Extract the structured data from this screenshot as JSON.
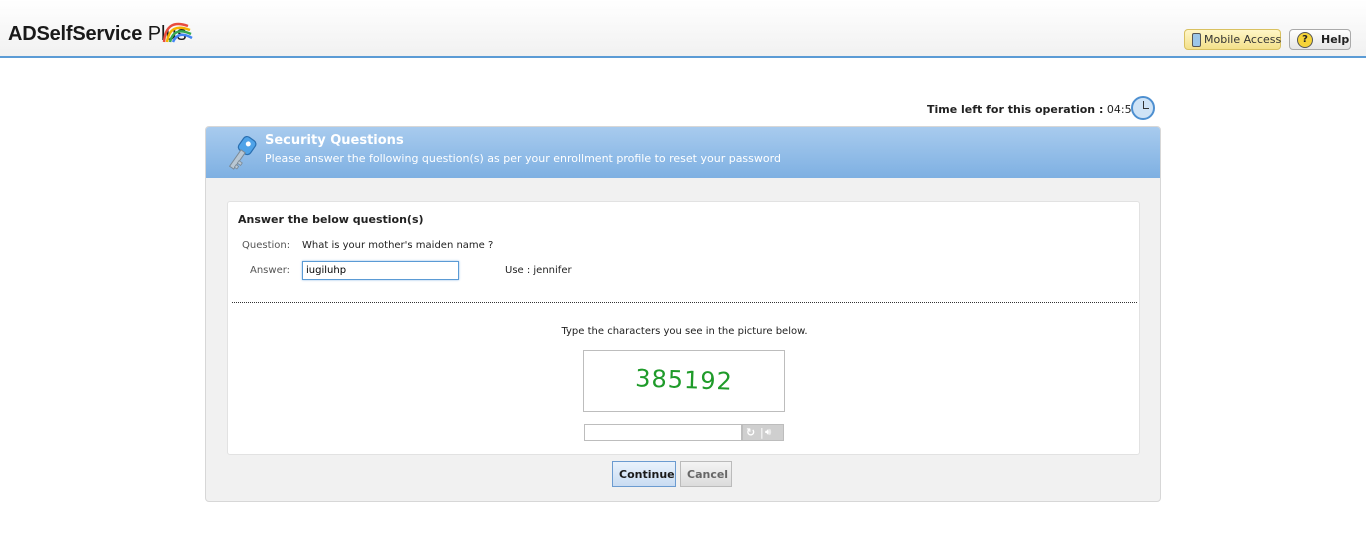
{
  "app": {
    "logo_text": "ADSelfService",
    "logo_plus": "Plus"
  },
  "header": {
    "mobile_access_label": "Mobile Access",
    "help_label": "Help"
  },
  "timer": {
    "label": "Time left for this operation :",
    "value": "04:50"
  },
  "panel": {
    "title": "Security Questions",
    "subtitle": "Please answer the following question(s) as per your enrollment profile to reset your password"
  },
  "form": {
    "heading": "Answer the below question(s)",
    "question_label": "Question:",
    "question_text": "What is your mother's maiden name ?",
    "answer_label": "Answer:",
    "answer_value": "iugiluhp",
    "hint": "Use : jennifer"
  },
  "captcha": {
    "instruction": "Type the characters you see in the picture below.",
    "image_text": "385192",
    "input_value": ""
  },
  "buttons": {
    "continue_label": "Continue",
    "cancel_label": "Cancel"
  },
  "icons": {
    "phone": "mobile-phone-icon",
    "help": "question-mark-icon",
    "clock": "clock-icon",
    "key": "key-icon",
    "refresh": "refresh-icon",
    "speaker": "speaker-icon"
  },
  "colors": {
    "header_accent": "#5b9bd5",
    "panel_header": "#7eb0e2",
    "captcha_text": "#1f9b2a"
  }
}
